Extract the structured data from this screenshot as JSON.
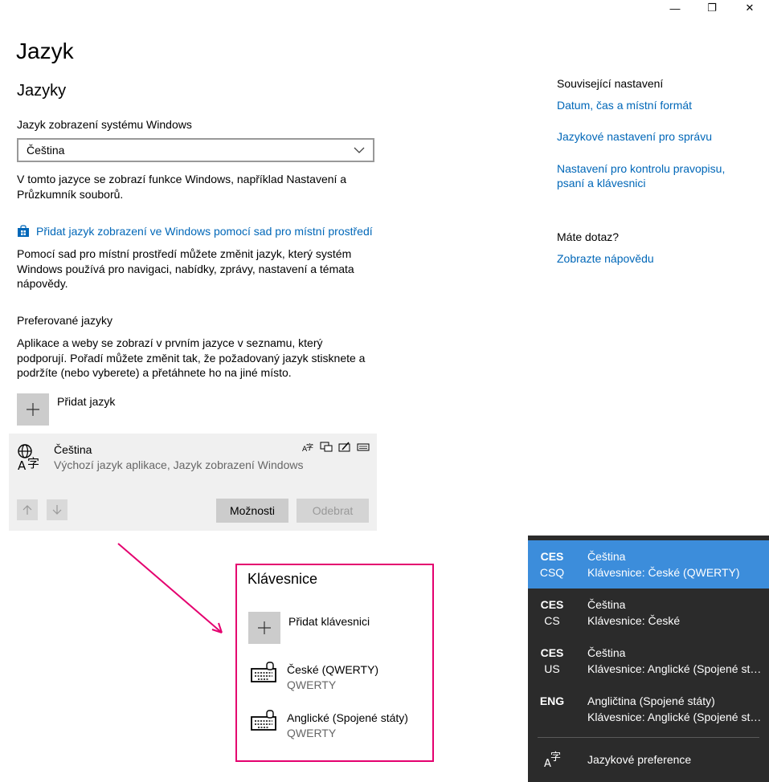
{
  "window": {
    "minimize_glyph": "—",
    "restore_glyph": "❐",
    "close_glyph": "✕"
  },
  "page": {
    "title": "Jazyk",
    "section_title": "Jazyky"
  },
  "display_language": {
    "label": "Jazyk zobrazení systému Windows",
    "selected": "Čeština",
    "description": "V tomto jazyce se zobrazí funkce Windows, například Nastavení a Průzkumník souborů.",
    "add_link": "Přidat jazyk zobrazení ve Windows pomocí sad pro místní prostředí",
    "add_link_description": "Pomocí sad pro místní prostředí můžete změnit jazyk, který systém Windows používá pro navigaci, nabídky, zprávy, nastavení a témata nápovědy."
  },
  "preferred": {
    "label": "Preferované jazyky",
    "description": "Aplikace a weby se zobrazí v prvním jazyce v seznamu, který podporují. Pořadí můžete změnit tak, že požadovaný jazyk stisknete a podržíte (nebo vyberete) a přetáhnete ho na jiné místo.",
    "add_label": "Přidat jazyk",
    "language": {
      "name": "Čeština",
      "detail": "Výchozí jazyk aplikace, Jazyk zobrazení Windows"
    },
    "options_button": "Možnosti",
    "remove_button": "Odebrat"
  },
  "related": {
    "heading": "Související nastavení",
    "links": [
      "Datum, čas a místní formát",
      "Jazykové nastavení pro správu",
      "Nastavení pro kontrolu pravopisu, psaní a klávesnici"
    ],
    "question_heading": "Máte dotaz?",
    "help_link": "Zobrazte nápovědu"
  },
  "keyboards": {
    "title": "Klávesnice",
    "add_label": "Přidat klávesnici",
    "items": [
      {
        "name": "České (QWERTY)",
        "layout": "QWERTY"
      },
      {
        "name": "Anglické (Spojené státy)",
        "layout": "QWERTY"
      }
    ]
  },
  "flyout": {
    "items": [
      {
        "code1": "CES",
        "code2": "CSQ",
        "lang": "Čeština",
        "kb": "Klávesnice: České (QWERTY)",
        "selected": true
      },
      {
        "code1": "CES",
        "code2": "CS",
        "lang": "Čeština",
        "kb": "Klávesnice: České",
        "selected": false
      },
      {
        "code1": "CES",
        "code2": "US",
        "lang": "Čeština",
        "kb": "Klávesnice: Anglické (Spojené státy)",
        "selected": false
      },
      {
        "code1": "ENG",
        "code2": "",
        "lang": "Angličtina (Spojené státy)",
        "kb": "Klávesnice: Anglické (Spojené státy)",
        "selected": false
      }
    ],
    "preferences_label": "Jazykové preference"
  },
  "colors": {
    "accent": "#0067b8",
    "highlight": "#3c8ddb",
    "flyout_bg": "#2b2b2b",
    "callout": "#e4006f"
  }
}
